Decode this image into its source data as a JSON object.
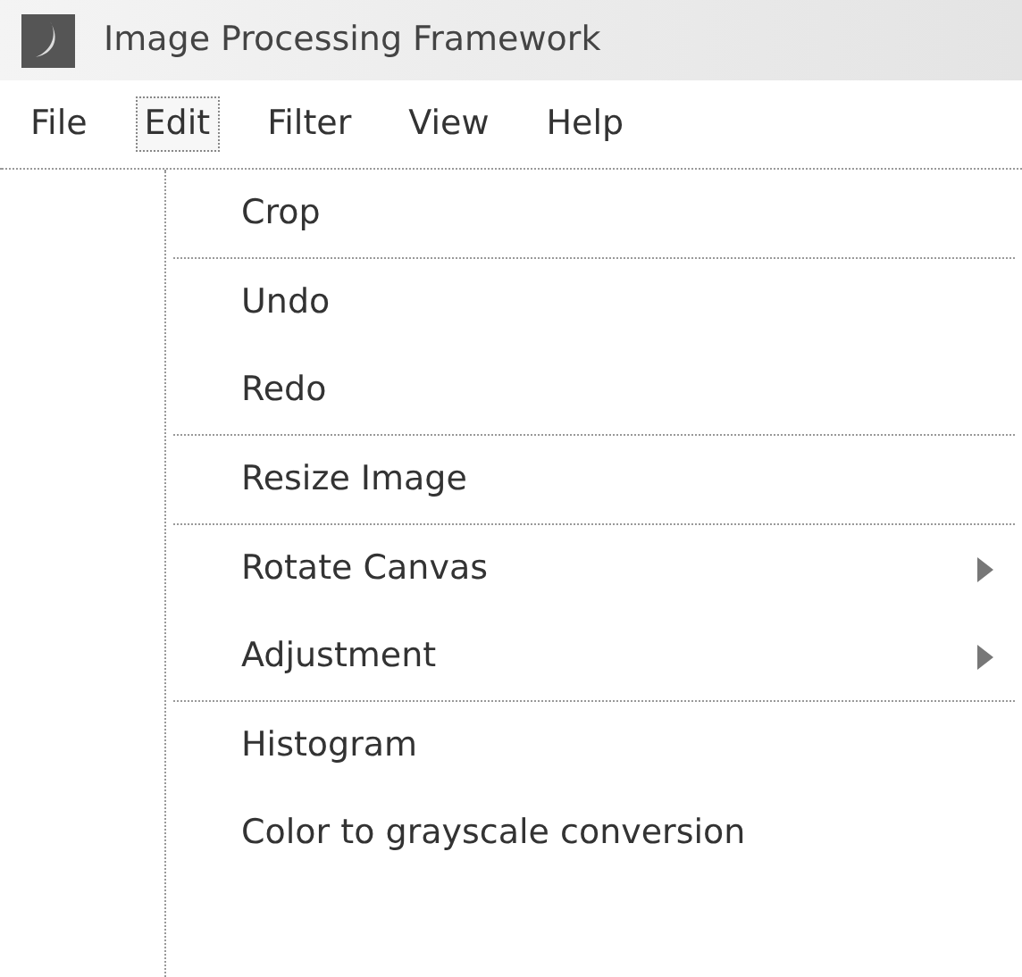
{
  "window": {
    "title": "Image Processing Framework"
  },
  "menu_bar": [
    {
      "label": "File",
      "selected": false
    },
    {
      "label": "Edit",
      "selected": true
    },
    {
      "label": "Filter",
      "selected": false
    },
    {
      "label": "View",
      "selected": false
    },
    {
      "label": "Help",
      "selected": false
    }
  ],
  "menu": [
    {
      "kind": "item",
      "label": "Crop",
      "has_submenu": false
    },
    {
      "kind": "separator"
    },
    {
      "kind": "item",
      "label": "Undo",
      "has_submenu": false
    },
    {
      "kind": "item",
      "label": "Redo",
      "has_submenu": false
    },
    {
      "kind": "separator"
    },
    {
      "kind": "item",
      "label": "Resize Image",
      "has_submenu": false
    },
    {
      "kind": "separator"
    },
    {
      "kind": "item",
      "label": "Rotate Canvas",
      "has_submenu": true
    },
    {
      "kind": "item",
      "label": "Adjustment",
      "has_submenu": true
    },
    {
      "kind": "separator"
    },
    {
      "kind": "item",
      "label": "Histogram",
      "has_submenu": false
    },
    {
      "kind": "item",
      "label": "Color to grayscale conversion",
      "has_submenu": false
    }
  ]
}
